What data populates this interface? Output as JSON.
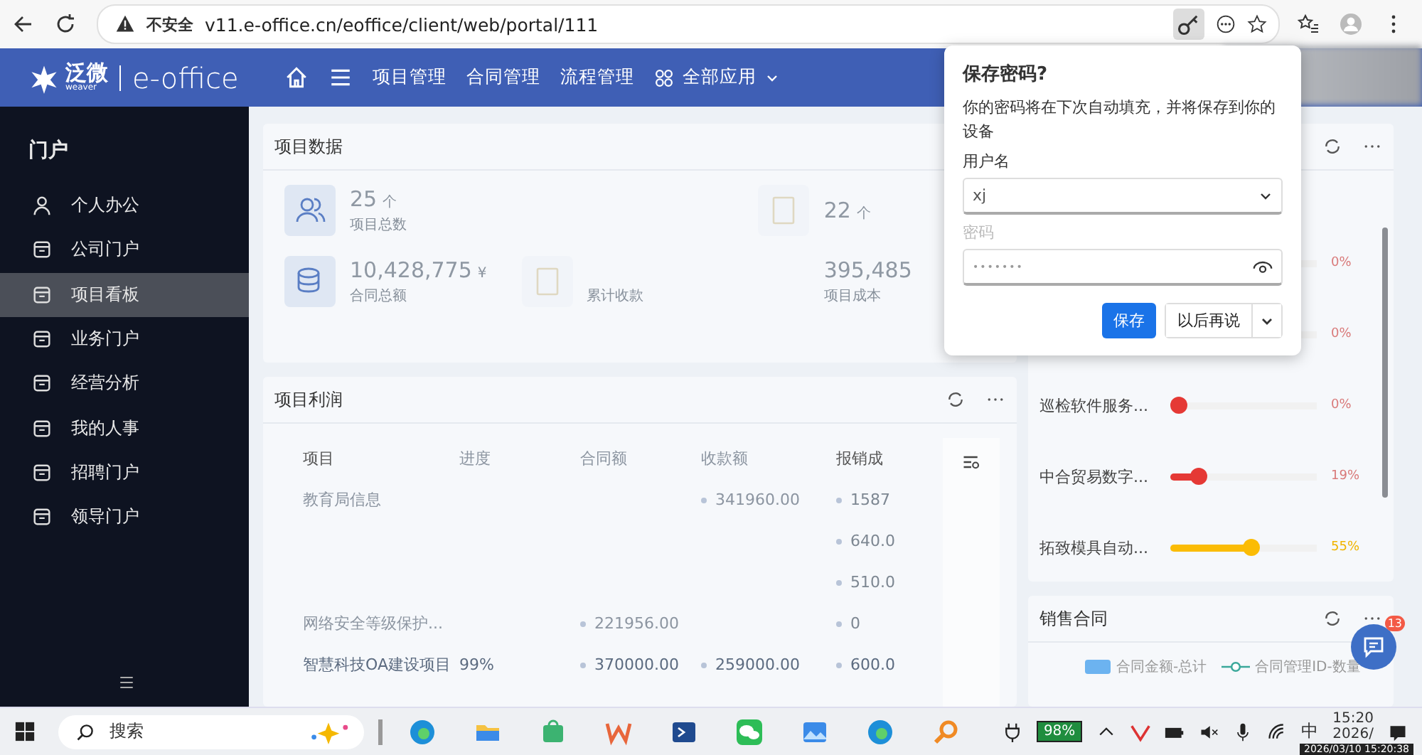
{
  "browser": {
    "security": "不安全",
    "url": "v11.e-office.cn/eoffice/client/web/portal/111"
  },
  "header": {
    "logo_cn": "泛微",
    "logo_sub": "weaver",
    "logo_en": "e-office",
    "nav": [
      "项目管理",
      "合同管理",
      "流程管理"
    ],
    "all_apps": "全部应用"
  },
  "sidebar": {
    "title": "门户",
    "items": [
      {
        "label": "个人办公",
        "selected": false
      },
      {
        "label": "公司门户",
        "selected": false
      },
      {
        "label": "项目看板",
        "selected": true
      },
      {
        "label": "业务门户",
        "selected": false
      },
      {
        "label": "经营分析",
        "selected": false
      },
      {
        "label": "我的人事",
        "selected": false
      },
      {
        "label": "招聘门户",
        "selected": false
      },
      {
        "label": "领导门户",
        "selected": false
      }
    ]
  },
  "project_data": {
    "title": "项目数据",
    "stats": [
      {
        "kind": "people",
        "value": "25",
        "unit": "个",
        "label": "项目总数"
      },
      {
        "kind": "blank"
      },
      {
        "kind": "document",
        "value": "22",
        "unit": "个"
      },
      {
        "kind": "coins",
        "value": "10,428,775",
        "unit": "¥",
        "label": "合同总额"
      },
      {
        "kind": "document",
        "label": "累计收款"
      },
      {
        "kind": "plain",
        "value": "395,485",
        "label": "项目成本"
      }
    ]
  },
  "project_profit": {
    "title": "项目利润",
    "columns": [
      "项目",
      "进度",
      "合同额",
      "收款额",
      "报销成"
    ],
    "rows": [
      {
        "cells": [
          "教育局信息",
          "",
          "",
          "341960.00",
          "1587"
        ]
      },
      {
        "cells": [
          "",
          "",
          "",
          "",
          "640.0"
        ]
      },
      {
        "cells": [
          "",
          "",
          "",
          "",
          "510.0"
        ]
      },
      {
        "cells": [
          "网络安全等级保护...",
          "",
          "221956.00",
          "",
          "0"
        ]
      },
      {
        "cells": [
          "智慧科技OA建设项目",
          "99%",
          "370000.00",
          "259000.00",
          "600.0"
        ]
      }
    ]
  },
  "progress": {
    "rows": [
      {
        "reading": "0%"
      },
      {
        "reading": "0%"
      },
      {
        "name": "巡检软件服务...",
        "level": 0,
        "reading": "0%",
        "color": "#e53935"
      },
      {
        "name": "中合贸易数字...",
        "level": 0.19,
        "reading": "19%",
        "color": "#e53935"
      },
      {
        "name": "拓致模具自动...",
        "level": 0.55,
        "reading": "55%",
        "color": "#fbbc05"
      }
    ]
  },
  "sales": {
    "title": "销售合同",
    "legend": [
      {
        "label": "合同金额-总计",
        "kind": "box"
      },
      {
        "label": "合同管理ID-数量",
        "kind": "line"
      }
    ]
  },
  "chat": {
    "badge": "13"
  },
  "dialog": {
    "title": "保存密码?",
    "text": "你的密码将在下次自动填充，并将保存到你的设备",
    "username_label": "用户名",
    "username": "xj",
    "password_label": "密码",
    "password": "•••••••",
    "save": "保存",
    "later": "以后再说"
  },
  "taskbar": {
    "search": "搜索",
    "battery": "98%",
    "ime": "中",
    "time": "15:20",
    "date": "2026/",
    "tooltip": "2026/03/10 15:20:38"
  }
}
